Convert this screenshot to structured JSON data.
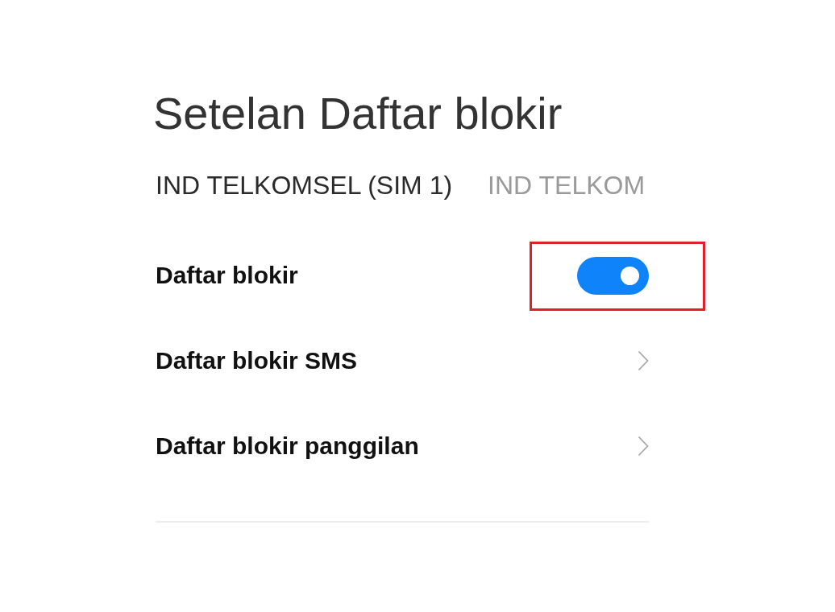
{
  "title": "Setelan Daftar blokir",
  "tabs": [
    {
      "label": "IND TELKOMSEL (SIM 1)",
      "selected": true
    },
    {
      "label": "IND TELKOM",
      "selected": false
    }
  ],
  "settings": [
    {
      "kind": "toggle",
      "label": "Daftar blokir",
      "on": true,
      "highlighted": true
    },
    {
      "kind": "link",
      "label": "Daftar blokir SMS",
      "highlighted": false
    },
    {
      "kind": "link",
      "label": "Daftar blokir panggilan",
      "highlighted": false
    }
  ]
}
